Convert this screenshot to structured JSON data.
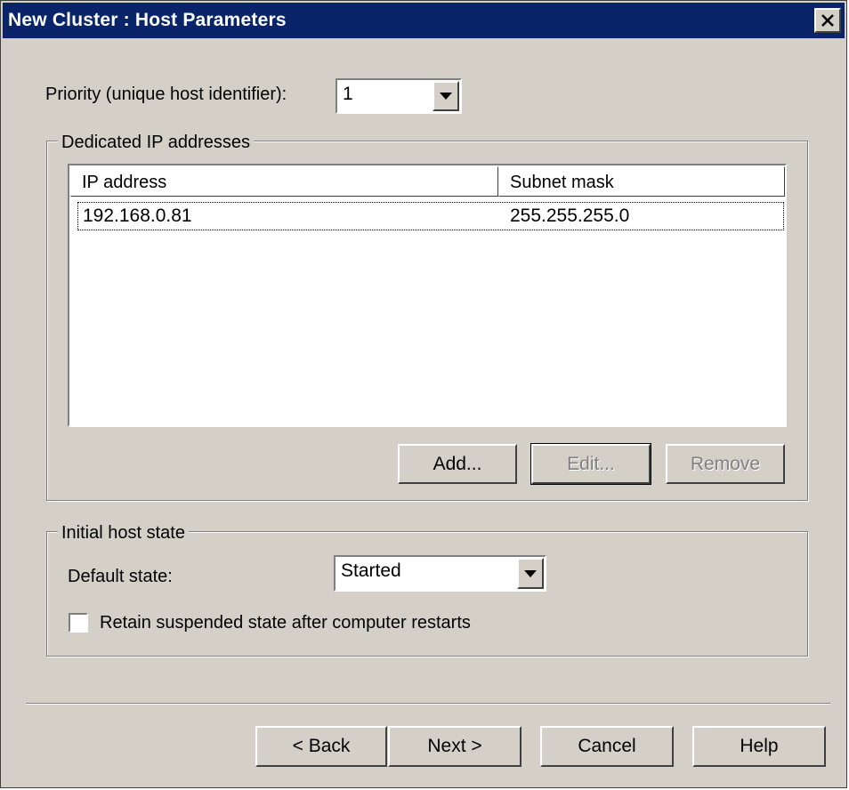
{
  "window": {
    "title": "New Cluster : Host Parameters"
  },
  "priority": {
    "label": "Priority (unique host identifier):",
    "value": "1"
  },
  "dedicated_ip": {
    "group_title": "Dedicated IP addresses",
    "columns": [
      "IP address",
      "Subnet mask"
    ],
    "rows": [
      {
        "ip": "192.168.0.81",
        "mask": "255.255.255.0"
      }
    ],
    "buttons": {
      "add": "Add...",
      "edit": "Edit...",
      "remove": "Remove"
    }
  },
  "initial_state": {
    "group_title": "Initial host state",
    "default_state_label": "Default state:",
    "default_state_value": "Started",
    "retain_label": "Retain suspended state after computer restarts",
    "retain_checked": false
  },
  "footer": {
    "back": "< Back",
    "next": "Next >",
    "cancel": "Cancel",
    "help": "Help"
  },
  "colors": {
    "titlebar": "#0a246a",
    "face": "#d4d0c8"
  },
  "icons": {
    "close": "close-icon",
    "dropdown": "chevron-down-icon"
  }
}
